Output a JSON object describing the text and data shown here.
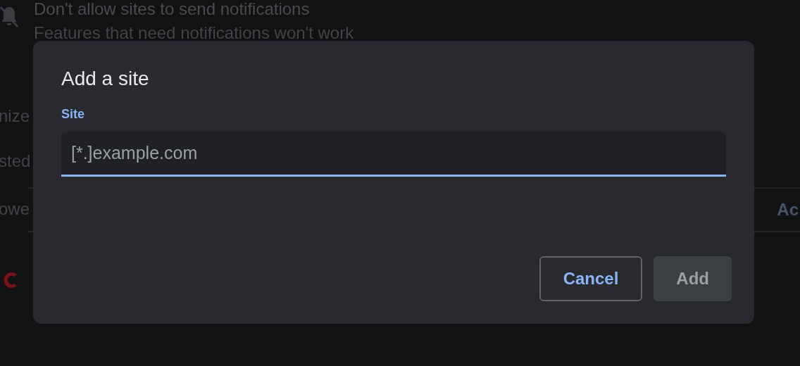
{
  "background": {
    "setting_title": "Don't allow sites to send notifications",
    "setting_subtitle": "Features that need notifications won't work",
    "cut_labels": [
      "nize",
      "sted",
      "owe"
    ],
    "section_action": "Ac"
  },
  "dialog": {
    "title": "Add a site",
    "field": {
      "label": "Site",
      "placeholder": "[*.]example.com",
      "focused": true
    },
    "buttons": [
      {
        "label": "Cancel",
        "kind": "outline",
        "disabled": false
      },
      {
        "label": "Add",
        "kind": "action",
        "disabled": true
      }
    ]
  }
}
